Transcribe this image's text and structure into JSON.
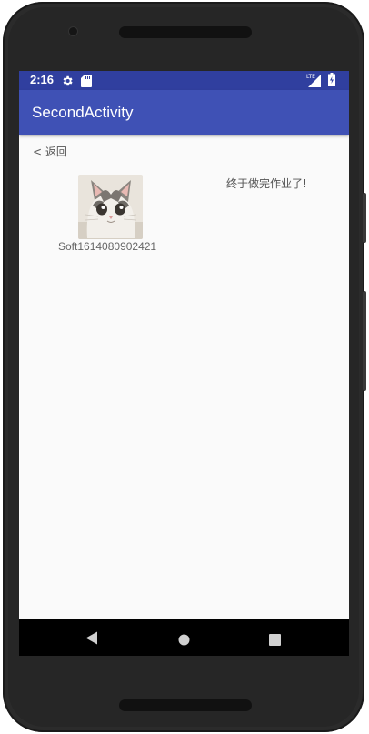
{
  "status_bar": {
    "time": "2:16",
    "icons": [
      "gear-icon",
      "sd-card-icon",
      "lte-signal-icon",
      "battery-charging-icon"
    ]
  },
  "app_bar": {
    "title": "SecondActivity"
  },
  "content": {
    "back_label": "< 返回",
    "image_caption": "Soft1614080902421",
    "message": "终于做完作业了!"
  },
  "nav_bar": {
    "buttons": [
      "back-icon",
      "home-icon",
      "recents-icon"
    ]
  },
  "colors": {
    "status_bar": "#303f9f",
    "app_bar": "#3f51b5",
    "background": "#fafafa",
    "nav_bar": "#000000"
  }
}
